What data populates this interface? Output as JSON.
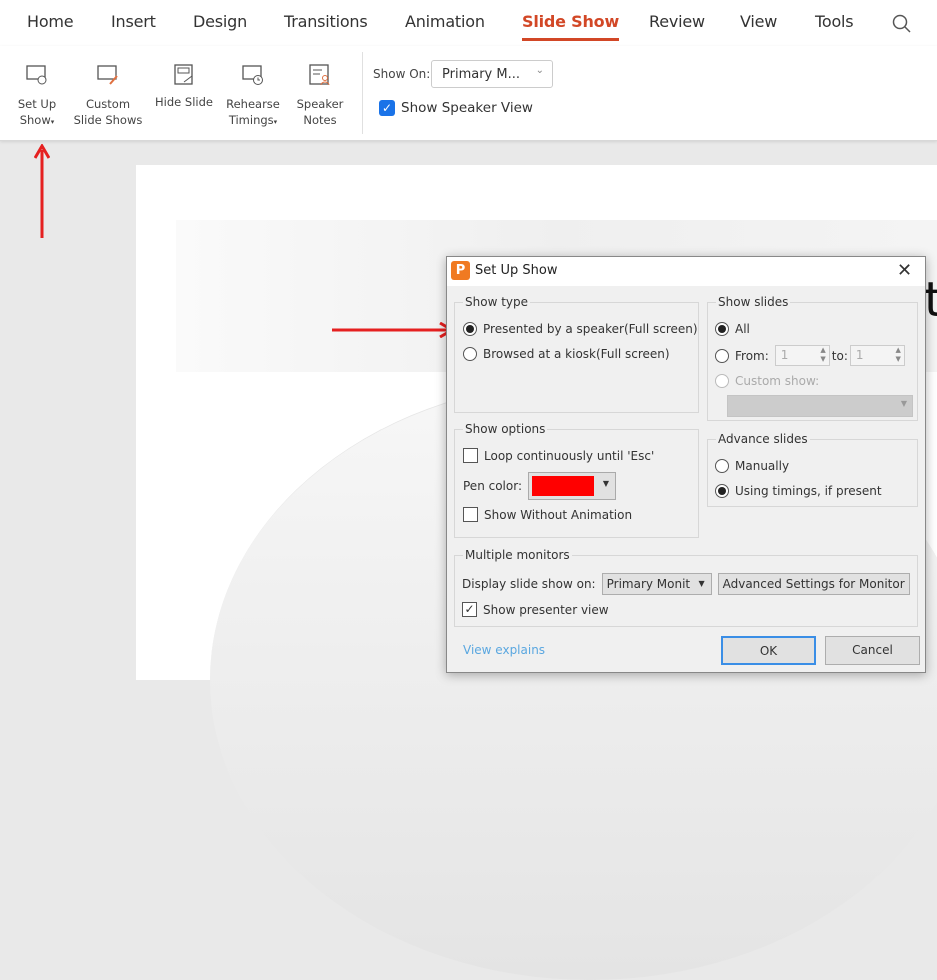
{
  "tabs": [
    "Home",
    "Insert",
    "Design",
    "Transitions",
    "Animation",
    "Slide Show",
    "Review",
    "View",
    "Tools"
  ],
  "active_tab": "Slide Show",
  "ribbon": {
    "buttons": [
      {
        "line1": "Set Up",
        "line2": "Show",
        "icon": "setup-show-icon"
      },
      {
        "line1": "Custom",
        "line2": "Slide Shows",
        "icon": "custom-slide-shows-icon"
      },
      {
        "line1": "Hide Slide",
        "line2": "",
        "icon": "hide-slide-icon"
      },
      {
        "line1": "Rehearse",
        "line2": "Timings",
        "icon": "rehearse-timings-icon"
      },
      {
        "line1": "Speaker",
        "line2": "Notes",
        "icon": "speaker-notes-icon"
      }
    ],
    "show_on_label": "Show On:",
    "show_on_value": "Primary M...",
    "show_speaker_view": "Show Speaker View",
    "show_speaker_view_checked": true
  },
  "slide_text": "t",
  "dialog": {
    "title": "Set Up Show",
    "show_type": {
      "legend": "Show type",
      "options": [
        "Presented by a speaker(Full screen)",
        "Browsed at a kiosk(Full screen)"
      ],
      "selected": 0
    },
    "show_slides": {
      "legend": "Show slides",
      "all": "All",
      "from": "From:",
      "from_value": "1",
      "to": "to:",
      "to_value": "1",
      "custom_show": "Custom show:",
      "selected": "All"
    },
    "show_options": {
      "legend": "Show options",
      "loop": "Loop continuously until 'Esc'",
      "loop_checked": false,
      "pen_color_label": "Pen color:",
      "pen_color": "#ff0000",
      "no_animation": "Show Without Animation",
      "no_animation_checked": false
    },
    "advance_slides": {
      "legend": "Advance slides",
      "options": [
        "Manually",
        "Using timings, if present"
      ],
      "selected": 1
    },
    "multiple_monitors": {
      "legend": "Multiple monitors",
      "display_label": "Display slide show on:",
      "display_value": "Primary Monit",
      "advanced_button": "Advanced Settings for Monitor",
      "presenter_view": "Show presenter view",
      "presenter_view_checked": true
    },
    "view_explains": "View explains",
    "ok": "OK",
    "cancel": "Cancel"
  },
  "colors": {
    "accent": "#d24726",
    "annotation_arrow": "#e52020",
    "checkbox_blue": "#1a73e8"
  }
}
